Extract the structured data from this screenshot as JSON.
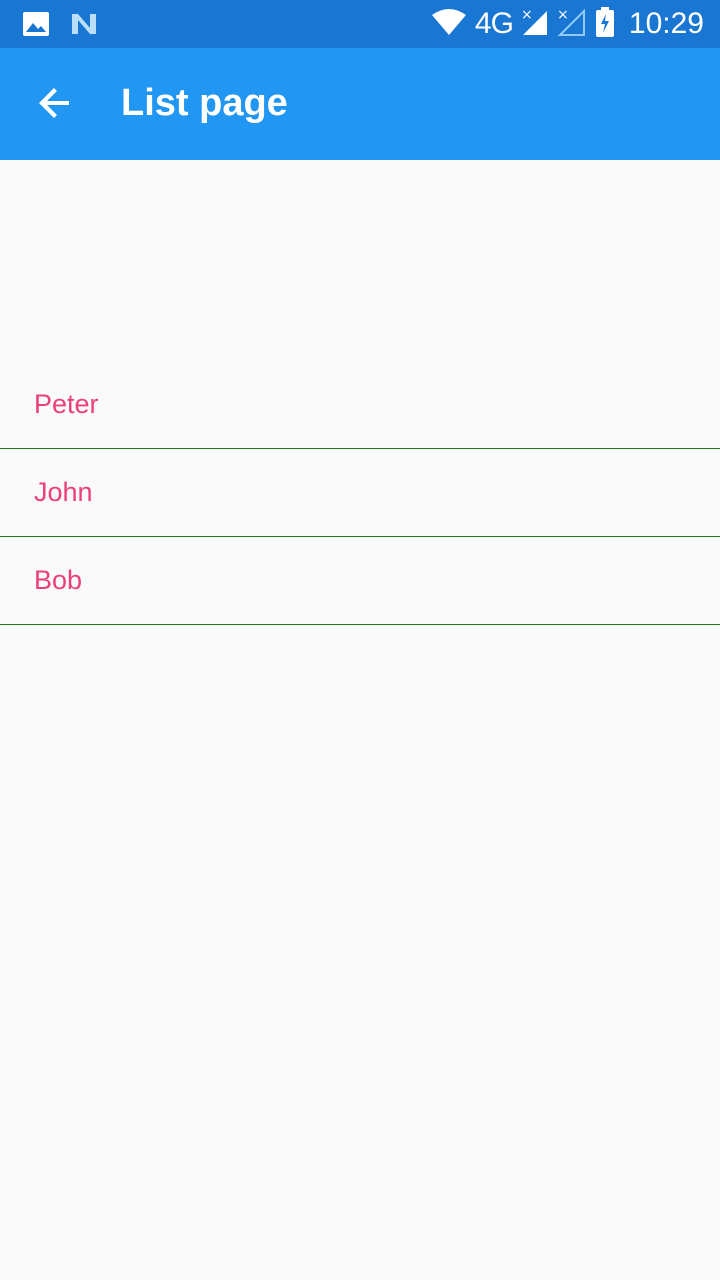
{
  "status_bar": {
    "network": "4G",
    "time": "10:29"
  },
  "app_bar": {
    "title": "List page"
  },
  "list": {
    "items": [
      {
        "label": "Peter"
      },
      {
        "label": "John"
      },
      {
        "label": "Bob"
      }
    ]
  },
  "colors": {
    "status_bar": "#1976D2",
    "app_bar": "#2196F3",
    "item_text": "#EC407A",
    "divider": "#1B7F1B",
    "background": "#FAFAFA"
  },
  "icons": [
    "image-icon",
    "n-icon",
    "wifi-icon",
    "signal-icon",
    "signal-off-icon",
    "battery-charging-icon",
    "back-arrow-icon"
  ]
}
